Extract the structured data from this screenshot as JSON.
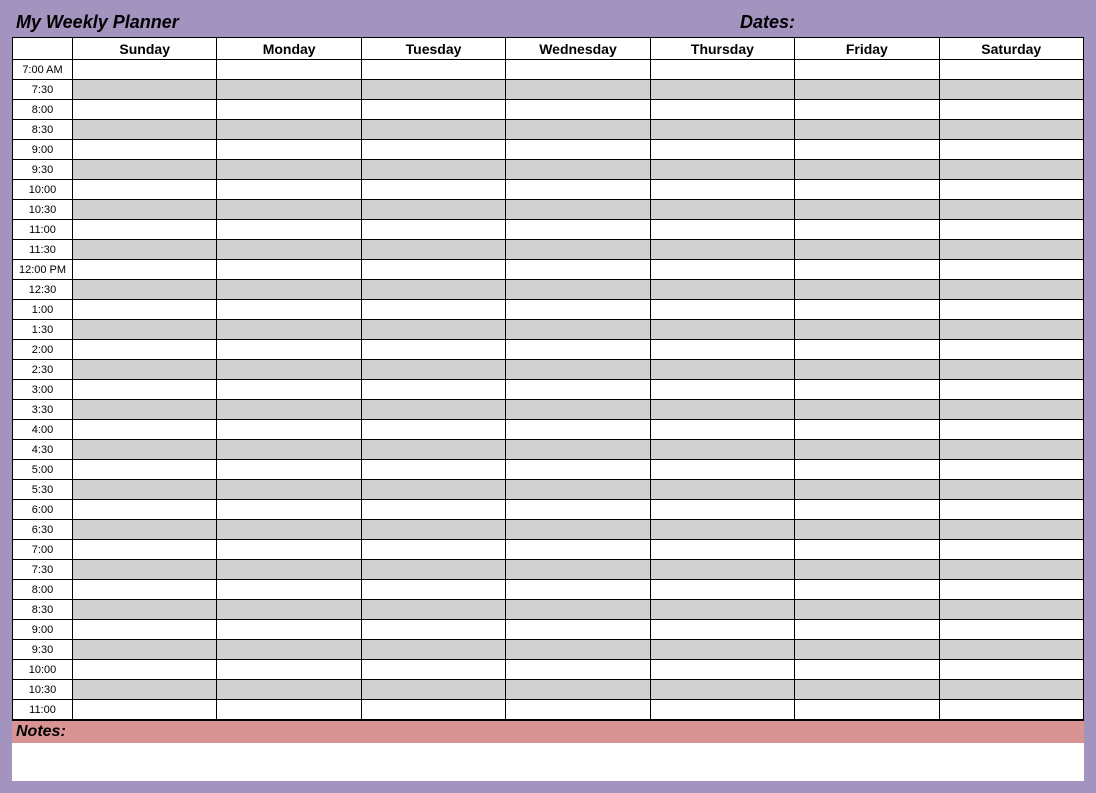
{
  "header": {
    "title": "My Weekly Planner",
    "dates_label": "Dates:"
  },
  "days": [
    "Sunday",
    "Monday",
    "Tuesday",
    "Wednesday",
    "Thursday",
    "Friday",
    "Saturday"
  ],
  "times": [
    "7:00 AM",
    "7:30",
    "8:00",
    "8:30",
    "9:00",
    "9:30",
    "10:00",
    "10:30",
    "11:00",
    "11:30",
    "12:00 PM",
    "12:30",
    "1:00",
    "1:30",
    "2:00",
    "2:30",
    "3:00",
    "3:30",
    "4:00",
    "4:30",
    "5:00",
    "5:30",
    "6:00",
    "6:30",
    "7:00",
    "7:30",
    "8:00",
    "8:30",
    "9:00",
    "9:30",
    "10:00",
    "10:30",
    "11:00"
  ],
  "notes": {
    "label": "Notes:"
  }
}
